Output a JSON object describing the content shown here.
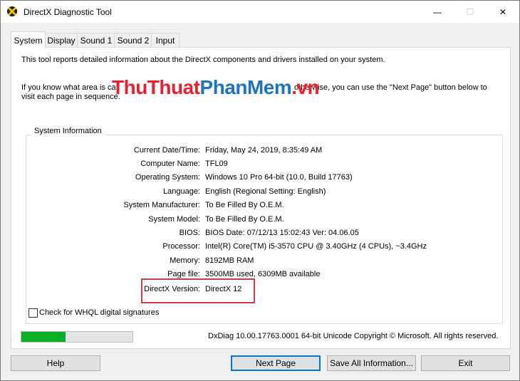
{
  "window": {
    "title": "DirectX Diagnostic Tool",
    "icon": "directx-icon",
    "controls": {
      "minimize": "—",
      "maximize": "☐",
      "close": "✕"
    }
  },
  "tabs": [
    {
      "label": "System",
      "active": true
    },
    {
      "label": "Display"
    },
    {
      "label": "Sound 1"
    },
    {
      "label": "Sound 2"
    },
    {
      "label": "Input"
    }
  ],
  "intro": {
    "line1": "This tool reports detailed information about the DirectX components and drivers installed on your system.",
    "line2a": "If you know what area is ca",
    "line2b": "otherwise, you can use the \"Next Page\" button below to",
    "line3": "visit each page in sequence."
  },
  "watermark": {
    "part1": "ThuThuat",
    "part2": "PhanMem",
    "part3": ".vn"
  },
  "system_info": {
    "group_title": "System Information",
    "rows": [
      {
        "label": "Current Date/Time:",
        "value": "Friday, May 24, 2019, 8:35:49 AM"
      },
      {
        "label": "Computer Name:",
        "value": "TFL09"
      },
      {
        "label": "Operating System:",
        "value": "Windows 10 Pro 64-bit (10.0, Build 17763)"
      },
      {
        "label": "Language:",
        "value": "English (Regional Setting: English)"
      },
      {
        "label": "System Manufacturer:",
        "value": "To Be Filled By O.E.M."
      },
      {
        "label": "System Model:",
        "value": "To Be Filled By O.E.M."
      },
      {
        "label": "BIOS:",
        "value": "BIOS Date: 07/12/13 15:02:43 Ver: 04.06.05"
      },
      {
        "label": "Processor:",
        "value": "Intel(R) Core(TM) i5-3570 CPU @ 3.40GHz (4 CPUs), ~3.4GHz"
      },
      {
        "label": "Memory:",
        "value": "8192MB RAM"
      },
      {
        "label": "Page file:",
        "value": "3500MB used, 6309MB available"
      },
      {
        "label": "DirectX Version:",
        "value": "DirectX 12"
      }
    ]
  },
  "whql_checkbox": {
    "label": "Check for WHQL digital signatures",
    "checked": false
  },
  "progress": {
    "fraction": 0.4
  },
  "version_line": "DxDiag 10.00.17763.0001 64-bit Unicode  Copyright © Microsoft. All rights reserved.",
  "buttons": {
    "help": "Help",
    "next_page": "Next Page",
    "save_all": "Save All Information...",
    "exit": "Exit"
  },
  "colors": {
    "progress_green": "#06b025",
    "highlight_red": "#d8393e",
    "focus_blue": "#0078d7"
  }
}
